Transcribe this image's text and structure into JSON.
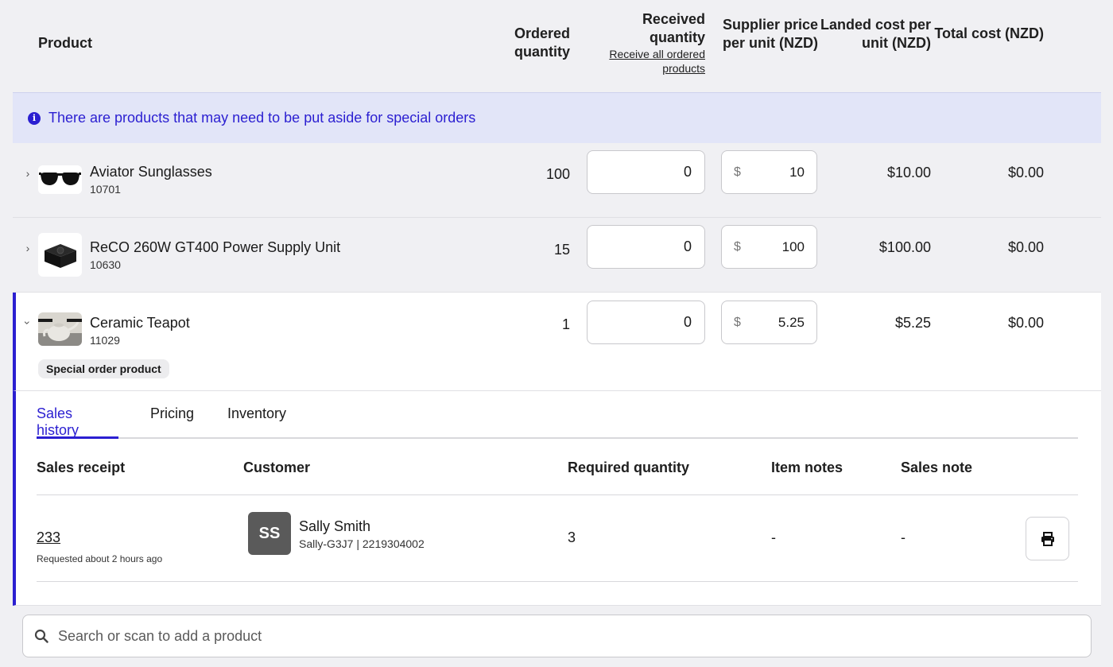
{
  "header": {
    "product": "Product",
    "ordered_quantity": "Ordered quantity",
    "received_quantity": "Received quantity",
    "receive_all_link": "Receive all ordered products",
    "supplier_price": "Supplier price per unit (NZD)",
    "landed_cost": "Landed cost per unit (NZD)",
    "total_cost": "Total cost (NZD)"
  },
  "banner": {
    "text": "There are products that may need to be put aside for special orders"
  },
  "rows": [
    {
      "name": "Aviator Sunglasses",
      "sku": "10701",
      "ordered": "100",
      "received": "0",
      "currency": "$",
      "supplier_price": "10",
      "landed": "$10.00",
      "total": "$0.00"
    },
    {
      "name": "ReCO 260W GT400 Power Supply Unit",
      "sku": "10630",
      "ordered": "15",
      "received": "0",
      "currency": "$",
      "supplier_price": "100",
      "landed": "$100.00",
      "total": "$0.00"
    },
    {
      "name": "Ceramic Teapot",
      "sku": "11029",
      "ordered": "1",
      "received": "0",
      "currency": "$",
      "supplier_price": "5.25",
      "landed": "$5.25",
      "total": "$0.00",
      "badge": "Special order product"
    }
  ],
  "detail": {
    "tabs": [
      "Sales history",
      "Pricing",
      "Inventory"
    ],
    "active_tab": "Sales history",
    "columns": {
      "receipt": "Sales receipt",
      "customer": "Customer",
      "required": "Required quantity",
      "item_notes": "Item notes",
      "sales_note": "Sales note"
    },
    "entries": [
      {
        "receipt": "233",
        "requested": "Requested about 2 hours ago",
        "initials": "SS",
        "customer_name": "Sally Smith",
        "customer_sub": "Sally-G3J7 | 2219304002",
        "required": "3",
        "item_notes": "-",
        "sales_note": "-"
      }
    ]
  },
  "search": {
    "placeholder": "Search or scan to add a product"
  },
  "colors": {
    "accent": "#2b1fd1",
    "banner_bg": "#e2e5f8",
    "row_bg": "#f0f0f3"
  }
}
